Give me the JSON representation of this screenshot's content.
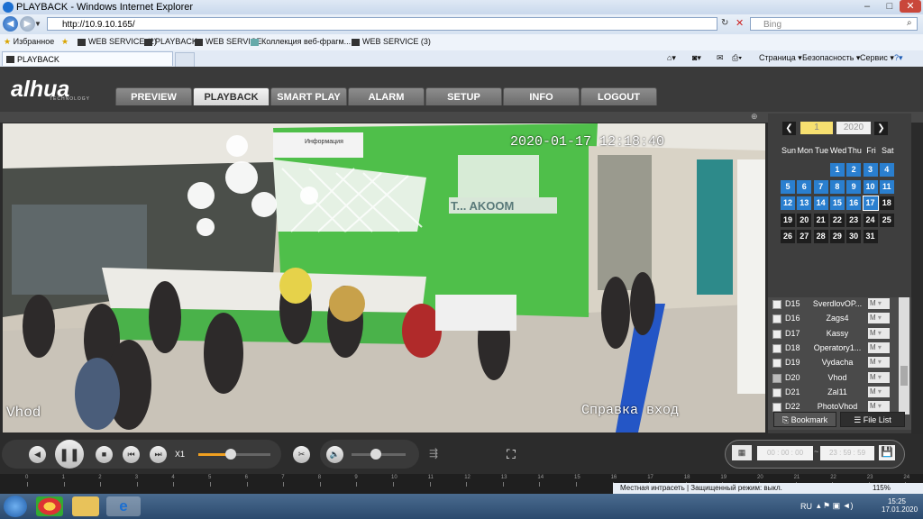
{
  "browser": {
    "window_title": "PLAYBACK - Windows Internet Explorer",
    "url": "http://10.9.10.165/",
    "search_placeholder": "Bing",
    "favorites_label": "Избранное",
    "favorites": [
      "WEB SERVICE (2)",
      "PLAYBACK",
      "WEB SERVICE",
      "Коллекция веб-фрагм...",
      "WEB SERVICE (3)"
    ],
    "tab_title": "PLAYBACK",
    "commands": [
      "Страница",
      "Безопасность",
      "Сервис"
    ]
  },
  "app": {
    "logo": "alhua",
    "logo_sub": "TECHNOLOGY",
    "nav": [
      "PREVIEW",
      "PLAYBACK",
      "SMART PLAY",
      "ALARM",
      "SETUP",
      "INFO",
      "LOGOUT"
    ],
    "active_nav": "PLAYBACK"
  },
  "video": {
    "timestamp": "2020-01-17 12:18:40",
    "channel_left": "Vhod",
    "channel_right": "Справка вход",
    "sign_text": "T... AKOOM",
    "info_sign": "Информация"
  },
  "calendar": {
    "month": "1",
    "year": "2020",
    "weekdays": [
      "Sun",
      "Mon",
      "Tue",
      "Wed",
      "Thu",
      "Fri",
      "Sat"
    ],
    "weeks": [
      [
        "",
        "",
        "",
        "1",
        "2",
        "3",
        "4"
      ],
      [
        "5",
        "6",
        "7",
        "8",
        "9",
        "10",
        "11"
      ],
      [
        "12",
        "13",
        "14",
        "15",
        "16",
        "17",
        "18"
      ],
      [
        "19",
        "20",
        "21",
        "22",
        "23",
        "24",
        "25"
      ],
      [
        "26",
        "27",
        "28",
        "29",
        "30",
        "31",
        ""
      ]
    ],
    "recorded_days": [
      "1",
      "2",
      "3",
      "4",
      "5",
      "6",
      "7",
      "8",
      "9",
      "10",
      "11",
      "12",
      "13",
      "14",
      "15",
      "16",
      "17"
    ],
    "selected_day": "17"
  },
  "channels": [
    {
      "id": "D15",
      "name": "SverdlovOP...",
      "mode": "M",
      "checked": false
    },
    {
      "id": "D16",
      "name": "Zags4",
      "mode": "M",
      "checked": false
    },
    {
      "id": "D17",
      "name": "Kassy",
      "mode": "M",
      "checked": false
    },
    {
      "id": "D18",
      "name": "Operatory1...",
      "mode": "M",
      "checked": false
    },
    {
      "id": "D19",
      "name": "Vydacha",
      "mode": "M",
      "checked": false
    },
    {
      "id": "D20",
      "name": "Vhod",
      "mode": "M",
      "checked": true
    },
    {
      "id": "D21",
      "name": "Zal11",
      "mode": "M",
      "checked": false
    },
    {
      "id": "D22",
      "name": "PhotoVhod",
      "mode": "M",
      "checked": false
    }
  ],
  "panel_buttons": {
    "bookmark": "Bookmark",
    "filelist": "File List"
  },
  "controls": {
    "speed": "X1",
    "time_start": "00 : 00 : 00",
    "time_end": "23 : 59 : 59",
    "time_separator": "~"
  },
  "timeline_ticks": [
    "0",
    "1",
    "2",
    "3",
    "4",
    "5",
    "6",
    "7",
    "8",
    "9",
    "10",
    "11",
    "12",
    "13",
    "14",
    "15",
    "16",
    "17",
    "18",
    "19",
    "20",
    "21",
    "22",
    "23",
    "24"
  ],
  "statusbar": {
    "zone": "Местная интрасеть | Защищенный режим: выкл.",
    "zoom": "115%"
  },
  "taskbar": {
    "lang": "RU",
    "time": "15:25",
    "date": "17.01.2020"
  }
}
